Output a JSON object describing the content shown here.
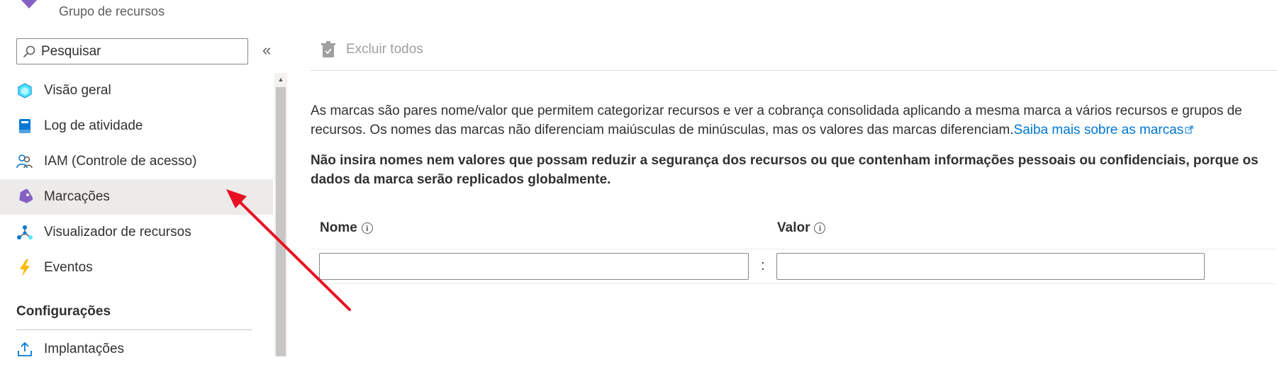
{
  "header": {
    "subtitle": "Grupo de recursos"
  },
  "sidebar": {
    "search": {
      "placeholder": "Pesquisar",
      "value": ""
    },
    "collapse_glyph": "«",
    "items": [
      {
        "label": "Visão geral",
        "icon": "overview-cube-icon",
        "active": false
      },
      {
        "label": "Log de atividade",
        "icon": "activity-log-icon",
        "active": false
      },
      {
        "label": "IAM (Controle de acesso)",
        "icon": "iam-people-icon",
        "active": false
      },
      {
        "label": "Marcações",
        "icon": "tag-icon",
        "active": true
      },
      {
        "label": "Visualizador de recursos",
        "icon": "resource-visualizer-icon",
        "active": false
      },
      {
        "label": "Eventos",
        "icon": "events-lightning-icon",
        "active": false
      }
    ],
    "section_header": "Configurações",
    "section_items": [
      {
        "label": "Implantações",
        "icon": "deployments-upload-icon"
      }
    ]
  },
  "toolbar": {
    "delete_all_label": "Excluir todos"
  },
  "content": {
    "description": "As marcas são pares nome/valor que permitem categorizar recursos e ver a cobrança consolidada aplicando a mesma marca a vários recursos e grupos de recursos. Os nomes das marcas não diferenciam maiúsculas de minúsculas, mas os valores das marcas diferenciam.",
    "learn_more_link": "Saiba mais sobre as marcas",
    "warning": "Não insira nomes nem valores que possam reduzir a segurança dos recursos ou que contenham informações pessoais ou confidenciais, porque os dados da marca serão replicados globalmente.",
    "table": {
      "name_header": "Nome",
      "value_header": "Valor",
      "separator": ":",
      "rows": [
        {
          "name": "",
          "value": ""
        }
      ]
    }
  },
  "colors": {
    "accent": "#0078d4",
    "annotation_arrow": "#e81123",
    "active_item_bg": "#edebe9",
    "tag_purple": "#8661c5"
  }
}
